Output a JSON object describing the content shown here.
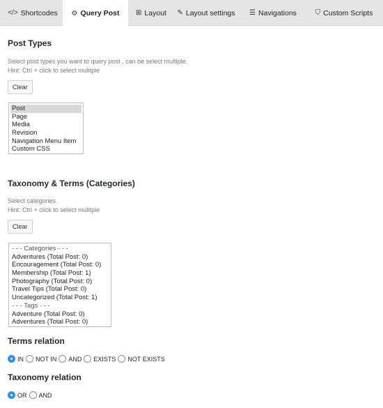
{
  "tabs": [
    {
      "icon": "</>",
      "label": "Shortcodes"
    },
    {
      "icon": "⚙",
      "label": "Query Post"
    },
    {
      "icon": "⊞",
      "label": "Layout"
    },
    {
      "icon": "✎",
      "label": "Layout settings"
    },
    {
      "icon": "☰",
      "label": "Navigations"
    },
    {
      "icon": "⛉",
      "label": "Custom Scripts"
    }
  ],
  "post_types": {
    "heading": "Post Types",
    "desc1": "Select post types you want to query post , can be select multiple.",
    "desc2": "Hint: Ctrl + click to select mulitple",
    "clear_label": "Clear",
    "options": [
      "Post",
      "Page",
      "Media",
      "Revision",
      "Navigation Menu Item",
      "Custom CSS"
    ],
    "selected": "Post"
  },
  "taxonomy": {
    "heading": "Taxonomy & Terms (Categories)",
    "desc1": "Select categories.",
    "desc2": "Hint: Ctrl + click to select mulitple",
    "clear_label": "Clear",
    "options": [
      "- - - Categories - - -",
      "Adventures (Total Post: 0)",
      "Encouragement (Total Post: 0)",
      "Membership (Total Post: 1)",
      "Photography (Total Post: 0)",
      "Travel Tips (Total Post: 0)",
      "Uncategorized (Total Post: 1)",
      "- - - Tags - - -",
      "Adventure (Total Post: 0)",
      "Adventures (Total Post: 0)"
    ]
  },
  "terms_relation": {
    "heading": "Terms relation",
    "options": [
      "IN",
      "NOT IN",
      "AND",
      "EXISTS",
      "NOT EXISTS"
    ],
    "selected": "IN"
  },
  "taxonomy_relation": {
    "heading": "Taxonomy relation",
    "options": [
      "OR",
      "AND"
    ],
    "selected": "OR"
  },
  "colors": {
    "accent": "#2f8ff3",
    "tab_bar": "#e5e5e5"
  }
}
